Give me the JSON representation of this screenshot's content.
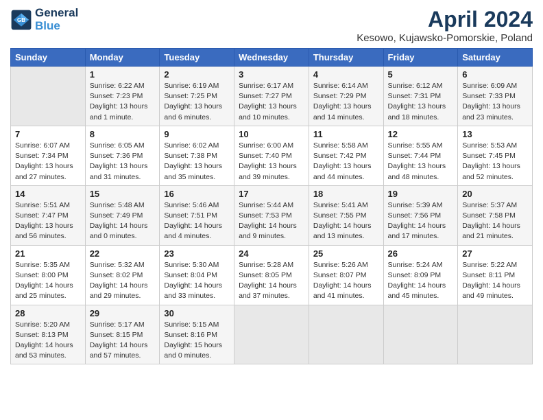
{
  "header": {
    "logo_line1": "General",
    "logo_line2": "Blue",
    "month_year": "April 2024",
    "location": "Kesowo, Kujawsko-Pomorskie, Poland"
  },
  "days_of_week": [
    "Sunday",
    "Monday",
    "Tuesday",
    "Wednesday",
    "Thursday",
    "Friday",
    "Saturday"
  ],
  "weeks": [
    [
      {
        "day": "",
        "info": ""
      },
      {
        "day": "1",
        "info": "Sunrise: 6:22 AM\nSunset: 7:23 PM\nDaylight: 13 hours\nand 1 minute."
      },
      {
        "day": "2",
        "info": "Sunrise: 6:19 AM\nSunset: 7:25 PM\nDaylight: 13 hours\nand 6 minutes."
      },
      {
        "day": "3",
        "info": "Sunrise: 6:17 AM\nSunset: 7:27 PM\nDaylight: 13 hours\nand 10 minutes."
      },
      {
        "day": "4",
        "info": "Sunrise: 6:14 AM\nSunset: 7:29 PM\nDaylight: 13 hours\nand 14 minutes."
      },
      {
        "day": "5",
        "info": "Sunrise: 6:12 AM\nSunset: 7:31 PM\nDaylight: 13 hours\nand 18 minutes."
      },
      {
        "day": "6",
        "info": "Sunrise: 6:09 AM\nSunset: 7:33 PM\nDaylight: 13 hours\nand 23 minutes."
      }
    ],
    [
      {
        "day": "7",
        "info": "Sunrise: 6:07 AM\nSunset: 7:34 PM\nDaylight: 13 hours\nand 27 minutes."
      },
      {
        "day": "8",
        "info": "Sunrise: 6:05 AM\nSunset: 7:36 PM\nDaylight: 13 hours\nand 31 minutes."
      },
      {
        "day": "9",
        "info": "Sunrise: 6:02 AM\nSunset: 7:38 PM\nDaylight: 13 hours\nand 35 minutes."
      },
      {
        "day": "10",
        "info": "Sunrise: 6:00 AM\nSunset: 7:40 PM\nDaylight: 13 hours\nand 39 minutes."
      },
      {
        "day": "11",
        "info": "Sunrise: 5:58 AM\nSunset: 7:42 PM\nDaylight: 13 hours\nand 44 minutes."
      },
      {
        "day": "12",
        "info": "Sunrise: 5:55 AM\nSunset: 7:44 PM\nDaylight: 13 hours\nand 48 minutes."
      },
      {
        "day": "13",
        "info": "Sunrise: 5:53 AM\nSunset: 7:45 PM\nDaylight: 13 hours\nand 52 minutes."
      }
    ],
    [
      {
        "day": "14",
        "info": "Sunrise: 5:51 AM\nSunset: 7:47 PM\nDaylight: 13 hours\nand 56 minutes."
      },
      {
        "day": "15",
        "info": "Sunrise: 5:48 AM\nSunset: 7:49 PM\nDaylight: 14 hours\nand 0 minutes."
      },
      {
        "day": "16",
        "info": "Sunrise: 5:46 AM\nSunset: 7:51 PM\nDaylight: 14 hours\nand 4 minutes."
      },
      {
        "day": "17",
        "info": "Sunrise: 5:44 AM\nSunset: 7:53 PM\nDaylight: 14 hours\nand 9 minutes."
      },
      {
        "day": "18",
        "info": "Sunrise: 5:41 AM\nSunset: 7:55 PM\nDaylight: 14 hours\nand 13 minutes."
      },
      {
        "day": "19",
        "info": "Sunrise: 5:39 AM\nSunset: 7:56 PM\nDaylight: 14 hours\nand 17 minutes."
      },
      {
        "day": "20",
        "info": "Sunrise: 5:37 AM\nSunset: 7:58 PM\nDaylight: 14 hours\nand 21 minutes."
      }
    ],
    [
      {
        "day": "21",
        "info": "Sunrise: 5:35 AM\nSunset: 8:00 PM\nDaylight: 14 hours\nand 25 minutes."
      },
      {
        "day": "22",
        "info": "Sunrise: 5:32 AM\nSunset: 8:02 PM\nDaylight: 14 hours\nand 29 minutes."
      },
      {
        "day": "23",
        "info": "Sunrise: 5:30 AM\nSunset: 8:04 PM\nDaylight: 14 hours\nand 33 minutes."
      },
      {
        "day": "24",
        "info": "Sunrise: 5:28 AM\nSunset: 8:05 PM\nDaylight: 14 hours\nand 37 minutes."
      },
      {
        "day": "25",
        "info": "Sunrise: 5:26 AM\nSunset: 8:07 PM\nDaylight: 14 hours\nand 41 minutes."
      },
      {
        "day": "26",
        "info": "Sunrise: 5:24 AM\nSunset: 8:09 PM\nDaylight: 14 hours\nand 45 minutes."
      },
      {
        "day": "27",
        "info": "Sunrise: 5:22 AM\nSunset: 8:11 PM\nDaylight: 14 hours\nand 49 minutes."
      }
    ],
    [
      {
        "day": "28",
        "info": "Sunrise: 5:20 AM\nSunset: 8:13 PM\nDaylight: 14 hours\nand 53 minutes."
      },
      {
        "day": "29",
        "info": "Sunrise: 5:17 AM\nSunset: 8:15 PM\nDaylight: 14 hours\nand 57 minutes."
      },
      {
        "day": "30",
        "info": "Sunrise: 5:15 AM\nSunset: 8:16 PM\nDaylight: 15 hours\nand 0 minutes."
      },
      {
        "day": "",
        "info": ""
      },
      {
        "day": "",
        "info": ""
      },
      {
        "day": "",
        "info": ""
      },
      {
        "day": "",
        "info": ""
      }
    ]
  ]
}
